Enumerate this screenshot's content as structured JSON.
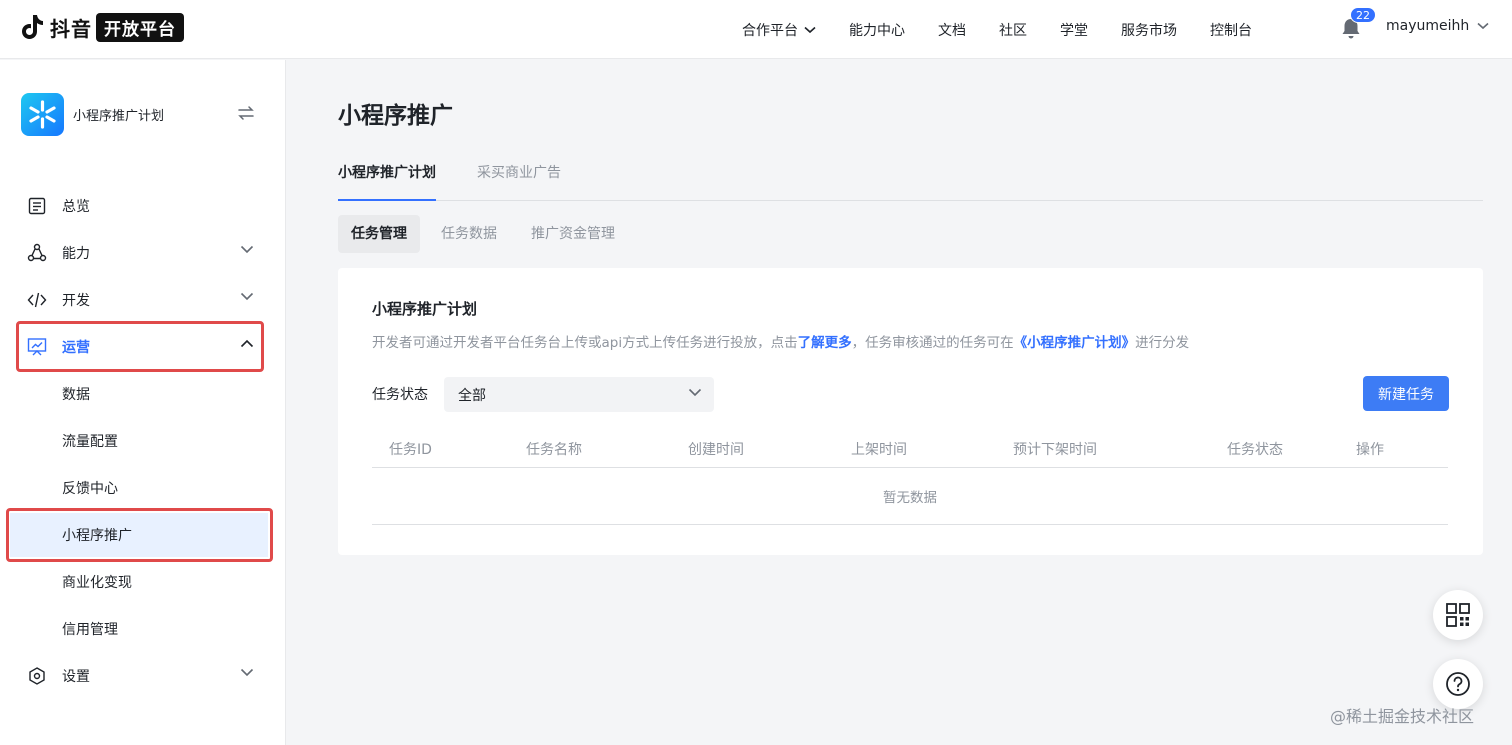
{
  "header": {
    "logo_text": "抖音",
    "logo_badge": "开放平台",
    "nav": [
      {
        "label": "合作平台"
      },
      {
        "label": "能力中心"
      },
      {
        "label": "文档"
      },
      {
        "label": "社区"
      },
      {
        "label": "学堂"
      },
      {
        "label": "服务市场"
      },
      {
        "label": "控制台"
      }
    ],
    "notification_count": "22",
    "username": "mayumeihh"
  },
  "sidebar": {
    "app_name": "小程序推广计划",
    "items": [
      {
        "label": "总览"
      },
      {
        "label": "能力"
      },
      {
        "label": "开发"
      },
      {
        "label": "运营"
      },
      {
        "label": "设置"
      }
    ],
    "sub_items": [
      {
        "label": "数据"
      },
      {
        "label": "流量配置"
      },
      {
        "label": "反馈中心"
      },
      {
        "label": "小程序推广"
      },
      {
        "label": "商业化变现"
      },
      {
        "label": "信用管理"
      }
    ]
  },
  "main": {
    "title": "小程序推广",
    "tabs": [
      {
        "label": "小程序推广计划"
      },
      {
        "label": "采买商业广告"
      }
    ],
    "subtabs": [
      {
        "label": "任务管理"
      },
      {
        "label": "任务数据"
      },
      {
        "label": "推广资金管理"
      }
    ],
    "card": {
      "title": "小程序推广计划",
      "desc_part1": "开发者可通过开发者平台任务台上传或api方式上传任务进行投放，点击",
      "desc_link1": "了解更多",
      "desc_part2": "，任务审核通过的任务可在",
      "desc_link2": "《小程序推广计划》",
      "desc_part3": "进行分发",
      "filter_label": "任务状态",
      "filter_value": "全部",
      "new_button": "新建任务",
      "columns": [
        "任务ID",
        "任务名称",
        "创建时间",
        "上架时间",
        "预计下架时间",
        "任务状态",
        "操作"
      ],
      "empty_text": "暂无数据"
    }
  },
  "watermark": "@稀土掘金技术社区",
  "colors": {
    "accent": "#3370ff",
    "highlight_box": "#e04a4a"
  }
}
